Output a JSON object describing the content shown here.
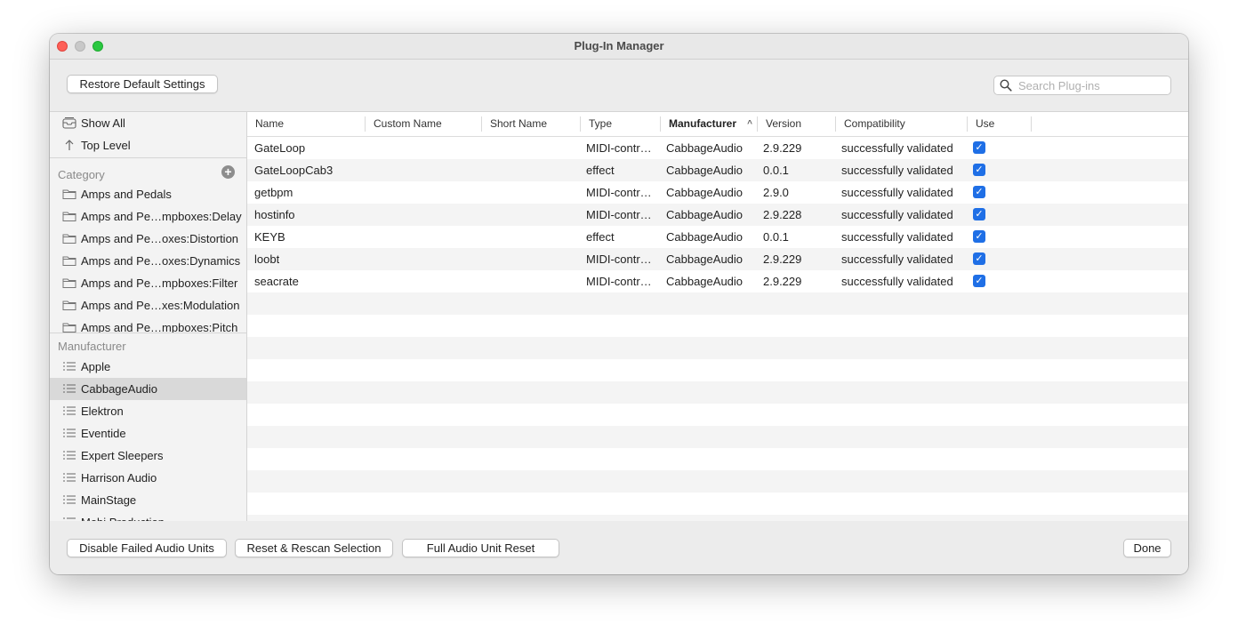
{
  "window": {
    "title": "Plug-In Manager"
  },
  "toolbar": {
    "restore_label": "Restore Default Settings",
    "search_placeholder": "Search Plug-ins"
  },
  "sidebar": {
    "top_items": [
      {
        "label": "Show All",
        "icon": "collection-icon"
      },
      {
        "label": "Top Level",
        "icon": "arrow-up-icon"
      }
    ],
    "category_header": "Category",
    "categories": [
      "Amps and Pedals",
      "Amps and Pe…mpboxes:Delay",
      "Amps and Pe…oxes:Distortion",
      "Amps and Pe…oxes:Dynamics",
      "Amps and Pe…mpboxes:Filter",
      "Amps and Pe…xes:Modulation",
      "Amps and Pe…mpboxes:Pitch"
    ],
    "manufacturer_header": "Manufacturer",
    "manufacturers": [
      "Apple",
      "CabbageAudio",
      "Elektron",
      "Eventide",
      "Expert Sleepers",
      "Harrison Audio",
      "MainStage",
      "Mobi Production"
    ],
    "selected_manufacturer": "CabbageAudio"
  },
  "table": {
    "columns": [
      "Name",
      "Custom Name",
      "Short Name",
      "Type",
      "Manufacturer",
      "Version",
      "Compatibility",
      "Use"
    ],
    "sorted_column": "Manufacturer",
    "rows": [
      {
        "name": "GateLoop",
        "custom": "",
        "short": "",
        "type": "MIDI-contr…",
        "manufacturer": "CabbageAudio",
        "version": "2.9.229",
        "compat": "successfully validated",
        "use": true
      },
      {
        "name": "GateLoopCab3",
        "custom": "",
        "short": "",
        "type": "effect",
        "manufacturer": "CabbageAudio",
        "version": "0.0.1",
        "compat": "successfully validated",
        "use": true
      },
      {
        "name": "getbpm",
        "custom": "",
        "short": "",
        "type": "MIDI-contr…",
        "manufacturer": "CabbageAudio",
        "version": "2.9.0",
        "compat": "successfully validated",
        "use": true
      },
      {
        "name": "hostinfo",
        "custom": "",
        "short": "",
        "type": "MIDI-contr…",
        "manufacturer": "CabbageAudio",
        "version": "2.9.228",
        "compat": "successfully validated",
        "use": true
      },
      {
        "name": "KEYB",
        "custom": "",
        "short": "",
        "type": "effect",
        "manufacturer": "CabbageAudio",
        "version": "0.0.1",
        "compat": "successfully validated",
        "use": true
      },
      {
        "name": "loobt",
        "custom": "",
        "short": "",
        "type": "MIDI-contr…",
        "manufacturer": "CabbageAudio",
        "version": "2.9.229",
        "compat": "successfully validated",
        "use": true
      },
      {
        "name": "seacrate",
        "custom": "",
        "short": "",
        "type": "MIDI-contr…",
        "manufacturer": "CabbageAudio",
        "version": "2.9.229",
        "compat": "successfully validated",
        "use": true
      }
    ]
  },
  "footer": {
    "disable_failed_label": "Disable Failed Audio Units",
    "reset_rescan_label": "Reset & Rescan Selection",
    "full_reset_label": "Full Audio Unit Reset",
    "done_label": "Done"
  },
  "colors": {
    "accent": "#1f6fe6",
    "selection": "#d9d9d9",
    "close": "#fe5f57",
    "zoom": "#2ac840"
  }
}
